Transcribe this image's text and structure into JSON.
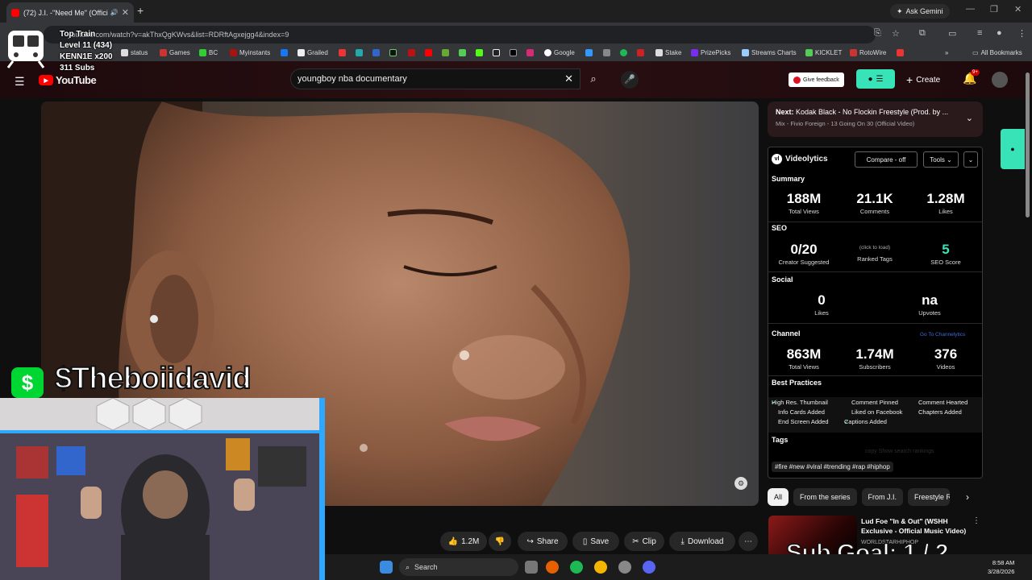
{
  "browser": {
    "tab_title": "(72) J.I. -\"Need Me\" (Officia",
    "tab_close": "✕",
    "new_tab": "+",
    "ask_gemini": "Ask Gemini",
    "url": "youtube.com/watch?v=akThxQgKWvs&list=RDRftAgxejgg4&index=9",
    "all_bookmarks": "All Bookmarks",
    "bookmarks": [
      "status",
      "Games",
      "BC",
      "Myinstants",
      "Grailed",
      "Google",
      "Stake",
      "PrizePicks",
      "Streams Charts",
      "KICKLET",
      "RotoWire"
    ]
  },
  "youtube": {
    "logo_text": "YouTube",
    "search_value": "youngboy nba documentary",
    "give_feedback": "Give feedback",
    "create": "Create",
    "notif_badge": "9+"
  },
  "up_next": {
    "label": "Next:",
    "title": "Kodak Black - No Flockin Freestyle (Prod. by ...",
    "subtitle": "Mix - Fivio Foreign - 13 Going On 30 (Official Video)"
  },
  "videolytics": {
    "brand": "Videolytics",
    "compare": "Compare - off",
    "tools": "Tools",
    "summary_label": "Summary",
    "summary": [
      {
        "value": "188M",
        "label": "Total Views"
      },
      {
        "value": "21.1K",
        "label": "Comments"
      },
      {
        "value": "1.28M",
        "label": "Likes"
      }
    ],
    "seo_label": "SEO",
    "seo": [
      {
        "value": "0/20",
        "label": "Creator Suggested"
      },
      {
        "value": "",
        "note": "(click to load)",
        "label": "Ranked Tags"
      },
      {
        "value": "5",
        "label": "SEO Score"
      }
    ],
    "social_label": "Social",
    "social": [
      {
        "value": "0",
        "label": "Likes"
      },
      {
        "value": "na",
        "label": "Upvotes"
      }
    ],
    "channel_label": "Channel",
    "channel_link": "Go To Channelytics",
    "channel": [
      {
        "value": "863M",
        "label": "Total Views"
      },
      {
        "value": "1.74M",
        "label": "Subscribers"
      },
      {
        "value": "376",
        "label": "Videos"
      }
    ],
    "best_practices_label": "Best Practices",
    "best_practices": [
      {
        "text": "High Res. Thumbnail",
        "done": true
      },
      {
        "text": "Comment Pinned",
        "done": false
      },
      {
        "text": "Comment Hearted",
        "done": false
      },
      {
        "text": "Info Cards Added",
        "done": false
      },
      {
        "text": "Liked on Facebook",
        "done": false
      },
      {
        "text": "Chapters Added",
        "done": false
      },
      {
        "text": "End Screen Added",
        "done": false
      },
      {
        "text": "Captions Added",
        "done": true
      }
    ],
    "tags_label": "Tags",
    "tags_actions": "copy   Show search rankings",
    "hashtags": "#fire #new #viral #trending #rap #hiphop"
  },
  "actions": {
    "likes": "1.2M",
    "share": "Share",
    "save": "Save",
    "clip": "Clip",
    "download": "Download"
  },
  "chips": [
    "All",
    "From the series",
    "From J.I.",
    "Freestyle R"
  ],
  "recommendation": {
    "title": "Lud Foe \"In & Out\" (WSHH Exclusive - Official Music Video)",
    "channel": "WORLDSTARHIPHOP"
  },
  "stream_overlay": {
    "train_title": "Top Train",
    "train_level": "Level 11  (434)",
    "train_user": "KENN1E x200",
    "train_subs": "311 Subs",
    "cashtag": "$Theboiidavid",
    "sub_goal": "Sub Goal:  1 / 2"
  },
  "taskbar": {
    "search": "Search",
    "time": "8:58 AM",
    "date": "3/28/2026"
  },
  "colors": {
    "accent_teal": "#37e3b7",
    "yt_red": "#ff0000",
    "cashapp_green": "#00d632"
  }
}
